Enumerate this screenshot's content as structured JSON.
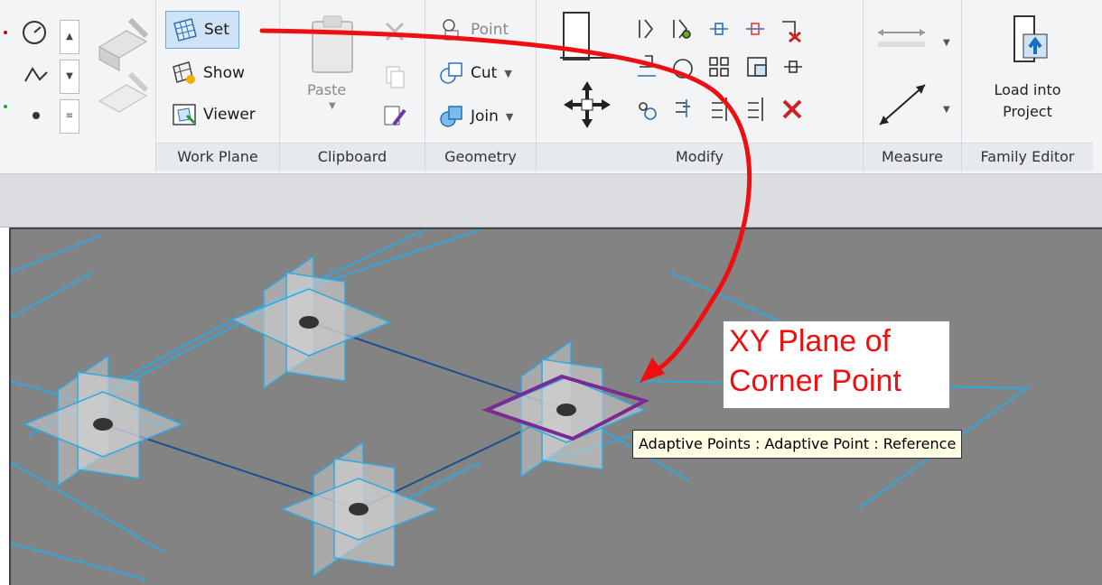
{
  "ribbon": {
    "panels": {
      "work_plane": {
        "title": "Work Plane",
        "set_label": "Set",
        "show_label": "Show",
        "viewer_label": "Viewer"
      },
      "clipboard": {
        "title": "Clipboard",
        "paste_label": "Paste"
      },
      "geometry": {
        "title": "Geometry",
        "point_label": "Point",
        "cut_label": "Cut",
        "join_label": "Join"
      },
      "modify": {
        "title": "Modify"
      },
      "measure": {
        "title": "Measure"
      },
      "family_editor": {
        "title": "Family Editor",
        "load_line1": "Load into",
        "load_line2": "Project"
      }
    }
  },
  "annotation": {
    "callout_line1": "XY Plane of",
    "callout_line2": "Corner Point",
    "tooltip": "Adaptive Points : Adaptive Point : Reference"
  },
  "colors": {
    "arrow": "#ee1010",
    "grid_line": "#2fa8e0",
    "highlight_plane": "#7a2a90",
    "viewport_bg": "#838383"
  }
}
